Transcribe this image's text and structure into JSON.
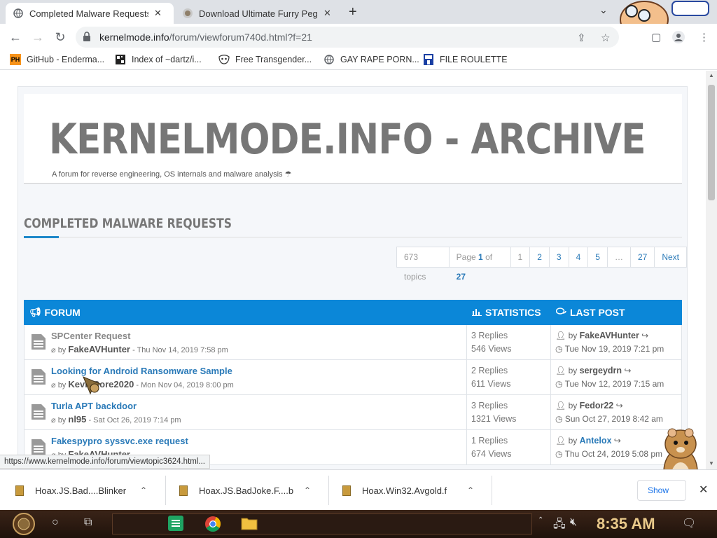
{
  "browser": {
    "tabs": [
      {
        "title": "Completed Malware Requests -",
        "active": true
      },
      {
        "title": "Download Ultimate Furry Pegg",
        "active": false
      }
    ],
    "url_host": "kernelmode.info",
    "url_path": "/forum/viewforum740d.html?f=21",
    "bookmarks": [
      {
        "label": "GitHub - Enderma...",
        "icon": "PH"
      },
      {
        "label": "Index of ~dartz/i...",
        "icon": "qr-icon"
      },
      {
        "label": "Free Transgender...",
        "icon": "mask-icon"
      },
      {
        "label": "GAY RAPE PORN...",
        "icon": "globe-icon"
      },
      {
        "label": "FILE ROULETTE",
        "icon": "file-icon"
      }
    ],
    "status_url": "https://www.kernelmode.info/forum/viewtopic3624.html..."
  },
  "site": {
    "title": "KERNELMODE.INFO - ARCHIVE",
    "description": "A forum for reverse engineering, OS internals and malware analysis"
  },
  "forum": {
    "heading": "COMPLETED MALWARE REQUESTS",
    "pagination": {
      "topics": "673 topics",
      "page_prefix": "Page",
      "page_current": "1",
      "page_of": "of",
      "page_total": "27",
      "pages": [
        "1",
        "2",
        "3",
        "4",
        "5",
        "…",
        "27"
      ],
      "next": "Next"
    },
    "columns": {
      "forum": "FORUM",
      "statistics": "STATISTICS",
      "last_post": "LAST POST"
    },
    "by": "by",
    "topics": [
      {
        "title": "SPCenter Request",
        "author": "FakeAVHunter",
        "date": "- Thu Nov 14, 2019 7:58 pm",
        "replies": "3 Replies",
        "views": "546 Views",
        "last_author": "FakeAVHunter",
        "last_date": "Tue Nov 19, 2019 7:21 pm"
      },
      {
        "title": "Looking for Android Ransomware Sample",
        "author": "KevinCore2020",
        "date": "- Mon Nov 04, 2019 8:00 pm",
        "replies": "2 Replies",
        "views": "611 Views",
        "last_author": "sergeydrn",
        "last_date": "Tue Nov 12, 2019 7:15 am"
      },
      {
        "title": "Turla APT backdoor",
        "author": "nl95",
        "date": "- Sat Oct 26, 2019 7:14 pm",
        "replies": "3 Replies",
        "views": "1321 Views",
        "last_author": "Fedor22",
        "last_date": "Sun Oct 27, 2019 8:42 am"
      },
      {
        "title": "Fakespypro syssvc.exe request",
        "author": "FakeAVHunter",
        "date": "",
        "replies": "1 Replies",
        "views": "674 Views",
        "last_author": "Antelox",
        "last_date": "Thu Oct 24, 2019 5:08 pm"
      }
    ]
  },
  "downloads": {
    "items": [
      "Hoax.JS.Bad....Blinker",
      "Hoax.JS.BadJoke.F....b",
      "Hoax.Win32.Avgold.f"
    ],
    "show_all": "Show"
  },
  "taskbar": {
    "time": "8:35 AM"
  },
  "colors": {
    "header_blue": "#0b87d8",
    "link_blue": "#2a7ab8",
    "title_gray": "#777777"
  }
}
